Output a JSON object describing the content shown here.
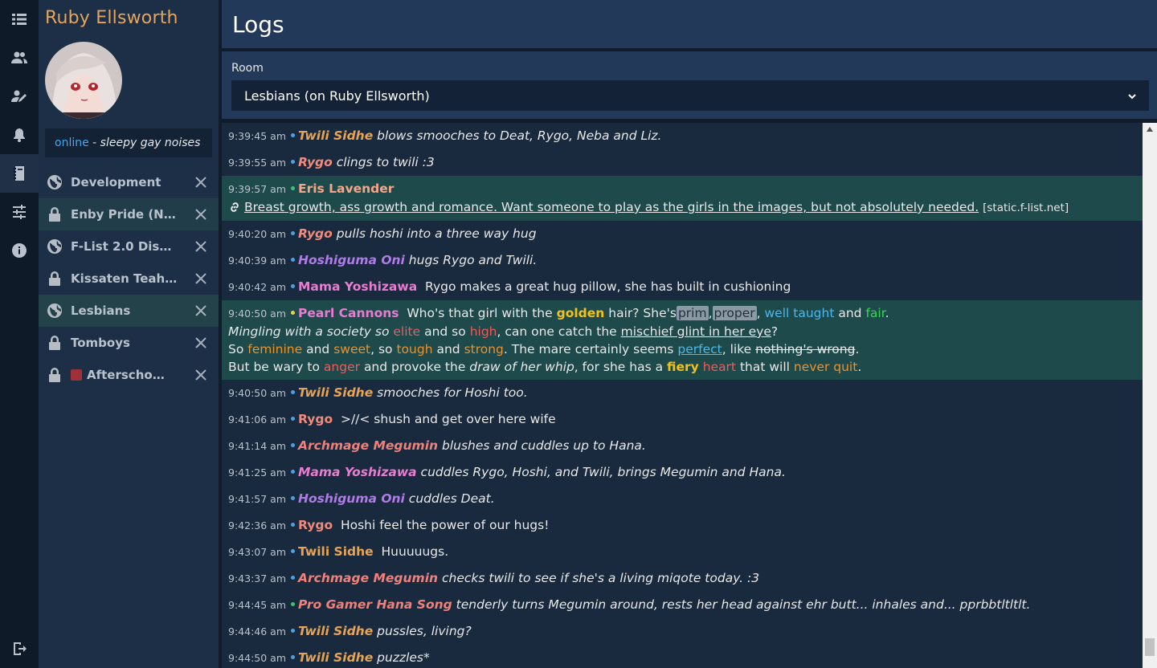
{
  "character": {
    "name": "Ruby Ellsworth",
    "status": "online",
    "separator": " - ",
    "status_message": "sleepy gay noises"
  },
  "rail": [
    {
      "icon": "menu-icon"
    },
    {
      "icon": "users-icon"
    },
    {
      "icon": "edit-user-icon"
    },
    {
      "icon": "bell-icon"
    },
    {
      "icon": "logs-icon"
    },
    {
      "icon": "settings-sliders-icon"
    },
    {
      "icon": "info-icon"
    },
    {
      "icon": "logout-icon"
    }
  ],
  "conversations": [
    {
      "label": "Development",
      "icon": "globe-icon"
    },
    {
      "label": "Enby Pride (Non-Binary)",
      "icon": "lock-icon"
    },
    {
      "label": "F-List 2.0 Discussion",
      "icon": "globe-icon"
    },
    {
      "label": "Kissaten Teahouse",
      "icon": "lock-icon"
    },
    {
      "label": "Lesbians",
      "icon": "globe-icon"
    },
    {
      "label": "Tomboys",
      "icon": "lock-icon"
    },
    {
      "label": "Afterschool Club",
      "icon": "lock-icon"
    }
  ],
  "header": {
    "title": "Logs"
  },
  "room": {
    "label": "Room",
    "selected": "Lesbians (on Ruby Ellsworth)"
  },
  "messages": [
    {
      "time": "9:39:45 am",
      "name": "Twili Sidhe",
      "text": "blows smooches to Deat, Rygo, Neba and Liz."
    },
    {
      "time": "9:39:55 am",
      "name": "Rygo",
      "text": "clings to twili :3"
    },
    {
      "time": "9:39:57 am",
      "name": "Eris Lavender",
      "link_text": "Breast growth, ass growth and romance. Want someone to play as the girls in the images, but not absolutely needed.",
      "link_domain": "[static.f-list.net]"
    },
    {
      "time": "9:40:20 am",
      "name": "Rygo",
      "text": "pulls hoshi into a three way hug"
    },
    {
      "time": "9:40:39 am",
      "name": "Hoshiguma Oni",
      "text": "hugs Rygo and Twili."
    },
    {
      "time": "9:40:42 am",
      "name": "Mama Yoshizawa",
      "text": "Rygo makes a great hug pillow, she has built in cushioning"
    },
    {
      "time": "9:40:50 am",
      "name": "Pearl Cannons"
    },
    {
      "time": "9:40:50 am",
      "name": "Twili Sidhe",
      "text": "smooches for Hoshi too."
    },
    {
      "time": "9:41:06 am",
      "name": "Rygo",
      "text": ">//< shush and get over here wife"
    },
    {
      "time": "9:41:14 am",
      "name": "Archmage Megumin",
      "text": "blushes and cuddles up to Hana."
    },
    {
      "time": "9:41:25 am",
      "name": "Mama Yoshizawa",
      "text": "cuddles Rygo, Hoshi, and Twili, brings Megumin and Hana."
    },
    {
      "time": "9:41:57 am",
      "name": "Hoshiguma Oni",
      "text": "cuddles Deat."
    },
    {
      "time": "9:42:36 am",
      "name": "Rygo",
      "text": "Hoshi feel the power of our hugs!"
    },
    {
      "time": "9:43:07 am",
      "name": "Twili Sidhe",
      "text": "Huuuuugs."
    },
    {
      "time": "9:43:37 am",
      "name": "Archmage Megumin",
      "text": "checks twili to see if she's a living miqote today. :3"
    },
    {
      "time": "9:44:45 am",
      "name": "Pro Gamer Hana Song",
      "text": "tenderly turns Megumin around, rests her head against ehr butt... inhales and...  pprbbtltltlt."
    },
    {
      "time": "9:44:46 am",
      "name": "Twili Sidhe",
      "text": "pussles, living?"
    },
    {
      "time": "9:44:50 am",
      "name": "Twili Sidhe",
      "text": "puzzles*"
    }
  ],
  "poem": {
    "l1_a": "Who's that girl with the",
    "l1_golden": "golden",
    "l1_b": "hair? She's",
    "l1_prim": "prim",
    "l1_comma": ",",
    "l1_proper": "proper",
    "l1_comma2": ",",
    "l1_well": "well taught",
    "l1_and": "and",
    "l1_fair": "fair",
    "l1_end": ".",
    "l2_a": "Mingling with a society so",
    "l2_elite": "elite",
    "l2_b": "and so",
    "l2_high": "high",
    "l2_c": ", can one catch the",
    "l2_glint": "mischief glint in her eye",
    "l2_end": "?",
    "l3_a": "So",
    "l3_feminine": "feminine",
    "l3_and1": "and",
    "l3_sweet": "sweet",
    "l3_so": ", so",
    "l3_tough": "tough",
    "l3_and2": "and",
    "l3_strong": "strong",
    "l3_b": ". The mare certainly seems",
    "l3_perfect": "perfect",
    "l3_like": ", like",
    "l3_nothing": "nothing's wrong",
    "l3_end": ".",
    "l4_a": "But be wary to",
    "l4_anger": "anger",
    "l4_b": "and provoke the",
    "l4_draw": "draw of her whip",
    "l4_c": ", for she has a",
    "l4_fiery": "fiery",
    "l4_heart": "heart",
    "l4_d": "that will",
    "l4_never": "never quit",
    "l4_end": "."
  }
}
